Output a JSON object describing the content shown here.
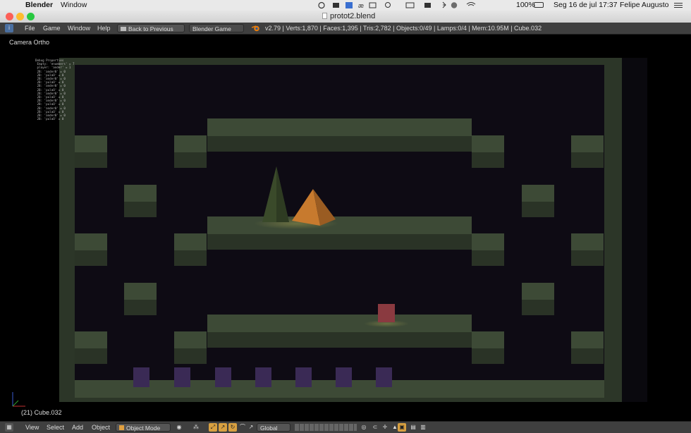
{
  "macmenu": {
    "app": "Blender",
    "window_menu": "Window",
    "battery": "100%",
    "datetime": "Seg 16 de jul  17:37",
    "user": "Felipe Augusto"
  },
  "window": {
    "title": "protot2.blend"
  },
  "info_header": {
    "menus": [
      "File",
      "Game",
      "Window",
      "Help"
    ],
    "back_button": "Back to Previous",
    "engine": "Blender Game",
    "stats": "v2.79 | Verts:1,870 | Faces:1,395 | Tris:2,782 | Objects:0/49 | Lamps:0/4 | Mem:10.95M | Cube.032"
  },
  "viewport": {
    "view_name": "Camera Ortho",
    "active_object": "(21) Cube.032",
    "debug_lines": [
      "Debug Properties",
      " Empty: 'enumbers' = 7",
      " player: 'ander' = 1",
      " 2B: 'ander0' = 0",
      " 2B: 'pulaO' = 0",
      " 2B: 'ander0' = 0",
      " 2B: 'pulaO' = 0",
      " 2B: 'ander0' = 0",
      " 2B: 'pulaO' = 0",
      " 2B: 'ander0' = 0",
      " 2B: 'pulaO' = 0",
      " 2B: 'ander0' = 0",
      " 2B: 'pulaO' = 0",
      " 2B: 'ander0' = 0",
      " 2B: 'pulaO' = 0",
      " 2B: 'ander0' = 0",
      " 2B: 'pulaO' = 0"
    ]
  },
  "bottom_header": {
    "menus": [
      "View",
      "Select",
      "Add",
      "Object"
    ],
    "mode": "Object Mode",
    "orientation": "Global"
  },
  "colors": {
    "platform_top": "#3d4a36",
    "platform_front": "#2a3326",
    "scene_bg": "#0e0b14",
    "wall": "#2c3628",
    "cone": "#3a4a2a",
    "pyramid": "#c77a2e",
    "cube": "#8a3a40",
    "purple_block": "#3a2a55",
    "blender_header": "#3f3f3f"
  }
}
